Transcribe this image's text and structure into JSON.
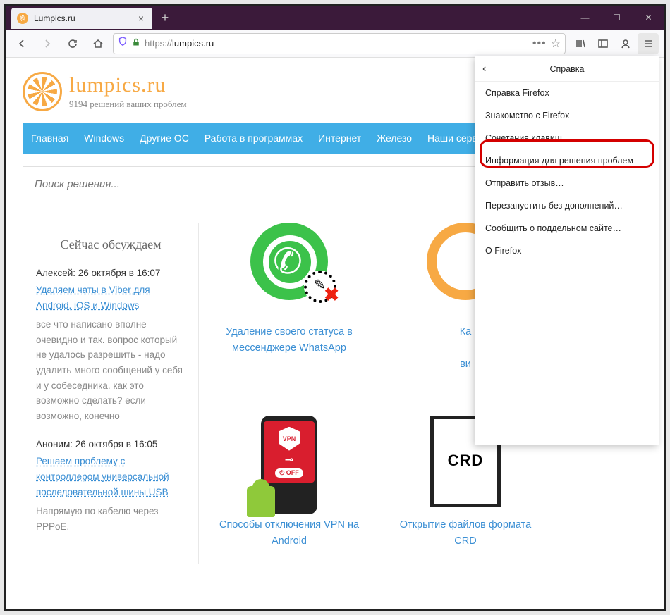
{
  "tab": {
    "title": "Lumpics.ru"
  },
  "url": {
    "proto": "https://",
    "host": "lumpics.ru"
  },
  "site": {
    "name": "lumpics.ru",
    "tagline": "9194 решений ваших проблем"
  },
  "nav": [
    "Главная",
    "Windows",
    "Другие ОС",
    "Работа в программах",
    "Интернет",
    "Железо",
    "Наши сервисы"
  ],
  "search_placeholder": "Поиск решения...",
  "sidebar": {
    "heading": "Сейчас обсуждаем",
    "comments": [
      {
        "meta": "Алексей: 26 октября в 16:07",
        "link": "Удаляем чаты в Viber для Android, iOS и Windows",
        "body": "все что написано вполне очевидно и так. вопрос который не удалось разрешить - надо удалить много сообщений у себя и у собеседника. как это возможно сделать? если возможно, конечно"
      },
      {
        "meta": "Аноним: 26 октября в 16:05",
        "link": "Решаем проблему с контроллером универсальной последовательной шины USB",
        "body": "Напрямую по кабелю через PPPoE."
      }
    ]
  },
  "articles": [
    {
      "title": "Удаление своего статуса в мессенджере WhatsApp"
    },
    {
      "title_l1": "Ка",
      "title_l2": "ви"
    },
    {
      "title": "Способы отключения VPN на Android"
    },
    {
      "title": "Открытие файлов формата CRD"
    }
  ],
  "help": {
    "title": "Справка",
    "items": [
      "Справка Firefox",
      "Знакомство с Firefox",
      "Сочетания клавиш",
      "Информация для решения проблем",
      "Отправить отзыв…",
      "Перезапустить без дополнений…",
      "Сообщить о поддельном сайте…",
      "О Firefox"
    ]
  },
  "vpn": {
    "label": "VPN",
    "off": "⏻ OFF"
  },
  "crd": "CRD"
}
